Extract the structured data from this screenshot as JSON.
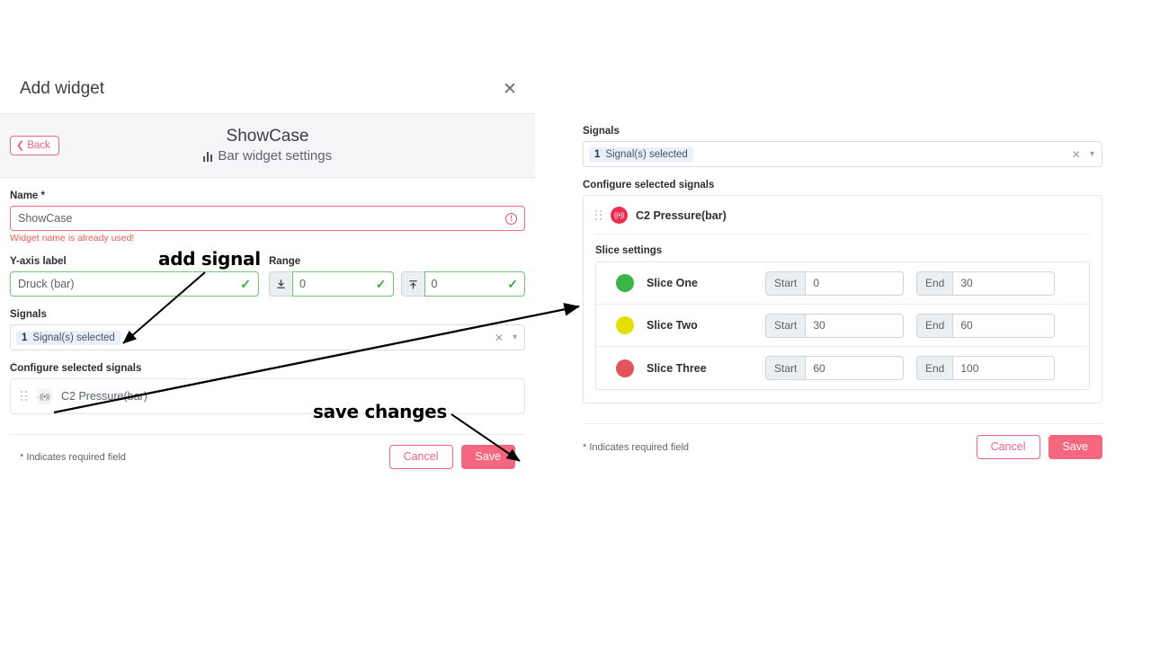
{
  "dialog": {
    "title": "Add widget",
    "close_icon": "close-icon",
    "back_label": "Back",
    "widget_name": "ShowCase",
    "widget_subtitle": "Bar widget settings",
    "subtitle_icon": "bar-chart-icon"
  },
  "form": {
    "name_label": "Name *",
    "name_value": "ShowCase",
    "name_error": "Widget name is already used!",
    "name_error_icon": "exclamation-circle-icon",
    "yaxis_label": "Y-axis label",
    "yaxis_value": "Druck (bar)",
    "yaxis_valid_icon": "check-icon",
    "range_label": "Range",
    "range_min_icon": "download-to-line-icon",
    "range_min_value": "0",
    "range_min_valid_icon": "check-icon",
    "range_max_icon": "upload-to-line-icon",
    "range_max_value": "0",
    "range_max_valid_icon": "check-icon",
    "signals_label": "Signals",
    "signals_count": "1",
    "signals_chip_text": "Signal(s) selected",
    "signals_clear_icon": "clear-x-icon",
    "signals_caret_icon": "chevron-down-icon",
    "configure_label": "Configure selected signals",
    "signal_row": {
      "grip_icon": "drag-handle-icon",
      "badge_icon": "signal-broadcast-icon",
      "name": "C2 Pressure(bar)"
    }
  },
  "footer": {
    "required_note": "* Indicates required field",
    "cancel_label": "Cancel",
    "save_label": "Save"
  },
  "right_panel": {
    "signals_label": "Signals",
    "signals_count": "1",
    "signals_chip_text": "Signal(s) selected",
    "signals_clear_icon": "clear-x-icon",
    "signals_caret_icon": "chevron-down-icon",
    "configure_label": "Configure selected signals",
    "signal_row": {
      "grip_icon": "drag-handle-icon",
      "badge_icon": "signal-broadcast-icon",
      "name": "C2 Pressure(bar)"
    },
    "slice_settings_label": "Slice settings",
    "start_label": "Start",
    "end_label": "End",
    "slices": [
      {
        "name": "Slice One",
        "color": "#3cb44a",
        "start": "0",
        "end": "30"
      },
      {
        "name": "Slice Two",
        "color": "#e3e000",
        "start": "30",
        "end": "60"
      },
      {
        "name": "Slice Three",
        "color": "#e0555a",
        "start": "60",
        "end": "100"
      }
    ],
    "required_note": "* Indicates required field",
    "cancel_label": "Cancel",
    "save_label": "Save"
  },
  "annotations": {
    "add_signal": "add signal",
    "save_changes": "save changes"
  },
  "colors": {
    "accent_pink": "#f4677f",
    "error_red": "#ee5a5a",
    "valid_green": "#3aa93a",
    "signal_badge_red": "#ef2b4e"
  }
}
